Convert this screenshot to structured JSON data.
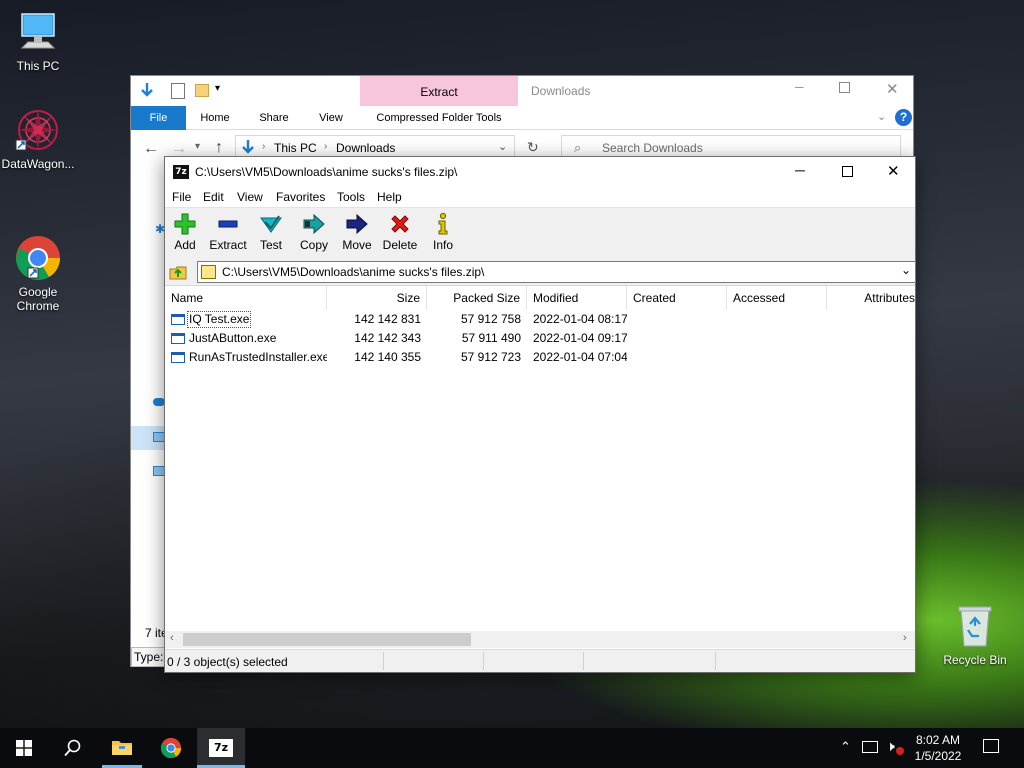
{
  "desktop": {
    "icons": [
      {
        "label": "This PC"
      },
      {
        "label": "DataWagon..."
      },
      {
        "label": "Google\nChrome"
      },
      {
        "label": "Recycle Bin"
      }
    ]
  },
  "explorer": {
    "ribbon_context_label": "Extract",
    "window_title": "Downloads",
    "tabs": [
      "File",
      "Home",
      "Share",
      "View",
      "Compressed Folder Tools"
    ],
    "breadcrumb": [
      "This PC",
      "Downloads"
    ],
    "search_placeholder": "Search Downloads",
    "status_items": "7 ite",
    "status_type": "Type:"
  },
  "sevenzip": {
    "title": "C:\\Users\\VM5\\Downloads\\anime sucks's files.zip\\",
    "menu": [
      "File",
      "Edit",
      "View",
      "Favorites",
      "Tools",
      "Help"
    ],
    "toolbar": [
      {
        "label": "Add",
        "icon": "add-icon",
        "color": "#2ec12e"
      },
      {
        "label": "Extract",
        "icon": "extract-icon",
        "color": "#1d3fbf"
      },
      {
        "label": "Test",
        "icon": "test-icon",
        "color": "#19b5c9"
      },
      {
        "label": "Copy",
        "icon": "copy-icon",
        "color": "#19a0a0"
      },
      {
        "label": "Move",
        "icon": "move-icon",
        "color": "#1a237e"
      },
      {
        "label": "Delete",
        "icon": "delete-icon",
        "color": "#e01b1b"
      },
      {
        "label": "Info",
        "icon": "info-icon",
        "color": "#e0c400"
      }
    ],
    "path": "C:\\Users\\VM5\\Downloads\\anime sucks's files.zip\\",
    "columns": [
      "Name",
      "Size",
      "Packed Size",
      "Modified",
      "Created",
      "Accessed",
      "Attributes"
    ],
    "rows": [
      {
        "name": "IQ Test.exe",
        "size": "142 142 831",
        "packed": "57 912 758",
        "modified": "2022-01-04 08:17"
      },
      {
        "name": "JustAButton.exe",
        "size": "142 142 343",
        "packed": "57 911 490",
        "modified": "2022-01-04 09:17"
      },
      {
        "name": "RunAsTrustedInstaller.exe",
        "size": "142 140 355",
        "packed": "57 912 723",
        "modified": "2022-01-04 07:04"
      }
    ],
    "status": "0 / 3 object(s) selected"
  },
  "taskbar": {
    "time": "8:02 AM",
    "date": "1/5/2022"
  },
  "colors": {
    "accent": "#0078d7",
    "ribbon_context": "#f7c6dc",
    "taskbar_bg": "#0a0b0e"
  }
}
